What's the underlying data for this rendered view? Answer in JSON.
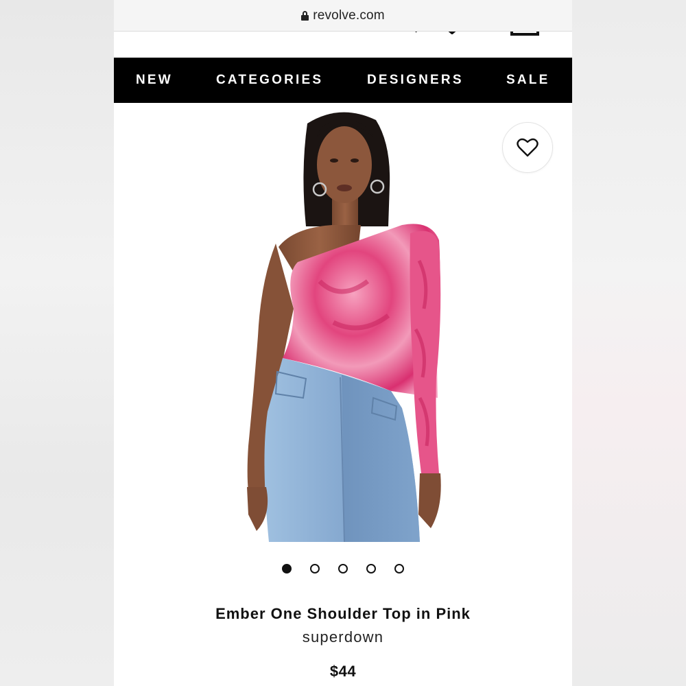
{
  "browser": {
    "url": "revolve.com",
    "lock_icon": "lock-icon"
  },
  "header": {
    "icons": [
      "search-icon",
      "chevron-down-icon",
      "shopping-bag-icon"
    ]
  },
  "nav": {
    "items": [
      {
        "label": "NEW"
      },
      {
        "label": "CATEGORIES"
      },
      {
        "label": "DESIGNERS"
      },
      {
        "label": "SALE"
      }
    ]
  },
  "product": {
    "image_description_icon": "product-photo",
    "wishlist_icon": "heart-icon",
    "carousel": {
      "total": 5,
      "active": 1
    },
    "title": "Ember One Shoulder Top in Pink",
    "designer": "superdown",
    "price": "$44"
  },
  "colors": {
    "nav_background": "#000000",
    "nav_text": "#ffffff",
    "top_pink": "#e8457f",
    "denim": "#8fb1d6"
  }
}
